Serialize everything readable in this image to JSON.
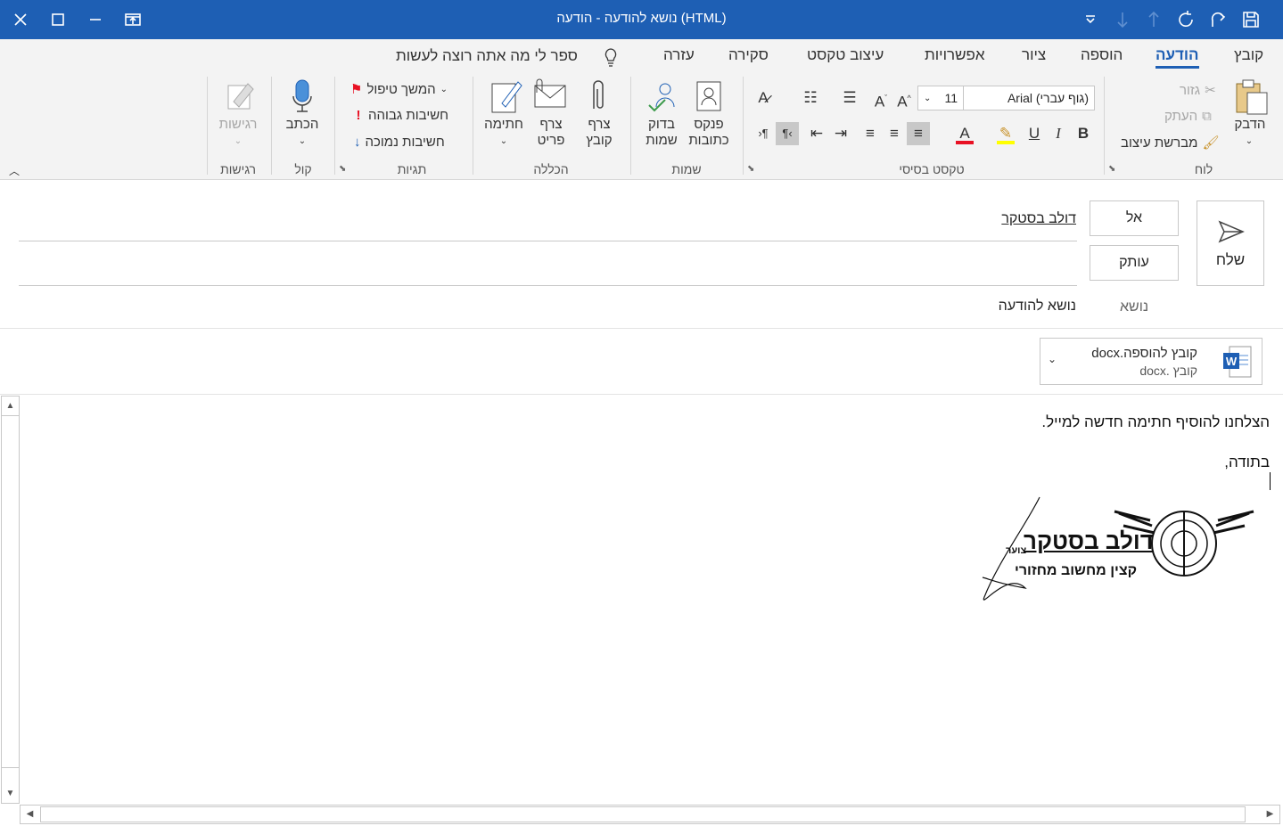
{
  "window": {
    "title": "נושא להודעה  -  הודעה (HTML)"
  },
  "tabs": [
    {
      "label": "קובץ"
    },
    {
      "label": "הודעה"
    },
    {
      "label": "הוספה"
    },
    {
      "label": "ציור"
    },
    {
      "label": "אפשרויות"
    },
    {
      "label": "עיצוב טקסט"
    },
    {
      "label": "סקירה"
    },
    {
      "label": "עזרה"
    }
  ],
  "tell_me": "ספר לי מה אתה רוצה לעשות",
  "groups": {
    "clipboard": {
      "label": "לוח",
      "paste": "הדבק",
      "cut": "גזור",
      "copy": "העתק",
      "format_painter": "מברשת עיצוב"
    },
    "basic_text": {
      "label": "טקסט בסיסי",
      "font": "(גוף עברי) Arial",
      "size": "11",
      "bold": "B",
      "italic": "I",
      "underline": "U"
    },
    "names": {
      "label": "שמות",
      "address_book": "פנקס\nכתובות",
      "check_names": "בדוק\nשמות"
    },
    "include": {
      "label": "הכללה",
      "attach_file": "צרף\nקובץ",
      "attach_item": "צרף\nפריט",
      "signature": "חתימה"
    },
    "tags": {
      "label": "תגיות",
      "follow_up": "המשך טיפול",
      "high_importance": "חשיבות גבוהה",
      "low_importance": "חשיבות נמוכה"
    },
    "voice": {
      "label": "קול",
      "dictate": "הכתב"
    },
    "sensitivity": {
      "label": "רגישות",
      "sensitivity": "רגישות"
    }
  },
  "header": {
    "send": "שלח",
    "to_button": "אל",
    "cc_button": "עותק",
    "to_value": "דולב בסטקר",
    "subject_label": "נושא",
    "subject_value": "נושא להודעה"
  },
  "attachment": {
    "name": "קובץ להוספה.docx",
    "type": "קובץ .docx"
  },
  "body": {
    "line1": "הצלחנו להוסיף חתימה חדשה למייל.",
    "line2": "בתודה,"
  },
  "signature": {
    "name": "דולב בסטקר",
    "rank": "צוער",
    "role": "קצין מחשוב מחזורי"
  },
  "colors": {
    "accent": "#1e5fb4",
    "font_color": "#e81123",
    "highlight": "#ffff00"
  }
}
